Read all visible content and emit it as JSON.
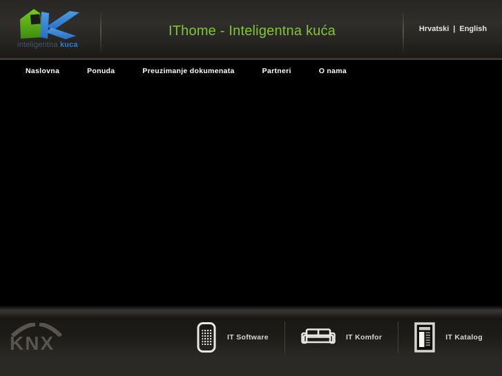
{
  "header": {
    "title": "IThome - Inteligentna kuća",
    "logo": {
      "word1": "inteligentna",
      "word2": "kuca"
    },
    "language": {
      "hr": "Hrvatski",
      "separator": "|",
      "en": "English"
    }
  },
  "nav": {
    "items": [
      {
        "label": "Naslovna"
      },
      {
        "label": "Ponuda"
      },
      {
        "label": "Preuzimanje dokumenata"
      },
      {
        "label": "Partneri"
      },
      {
        "label": "O nama"
      }
    ]
  },
  "footer": {
    "knx": "KNX",
    "items": [
      {
        "icon": "remote-icon",
        "label": "IT Software"
      },
      {
        "icon": "sofa-icon",
        "label": "IT Komfor"
      },
      {
        "icon": "catalog-icon",
        "label": "IT Katalog"
      }
    ]
  },
  "colors": {
    "title_green": "#7fc636",
    "logo_green_top": "#74ca20",
    "logo_green_bottom": "#3f8d0e",
    "logo_blue": "#3b86d8",
    "logo_text_blue": "#2c7cd4",
    "nav_text": "#ffffff",
    "footer_label": "#d8d7d3",
    "knx_gray": "#585550"
  }
}
